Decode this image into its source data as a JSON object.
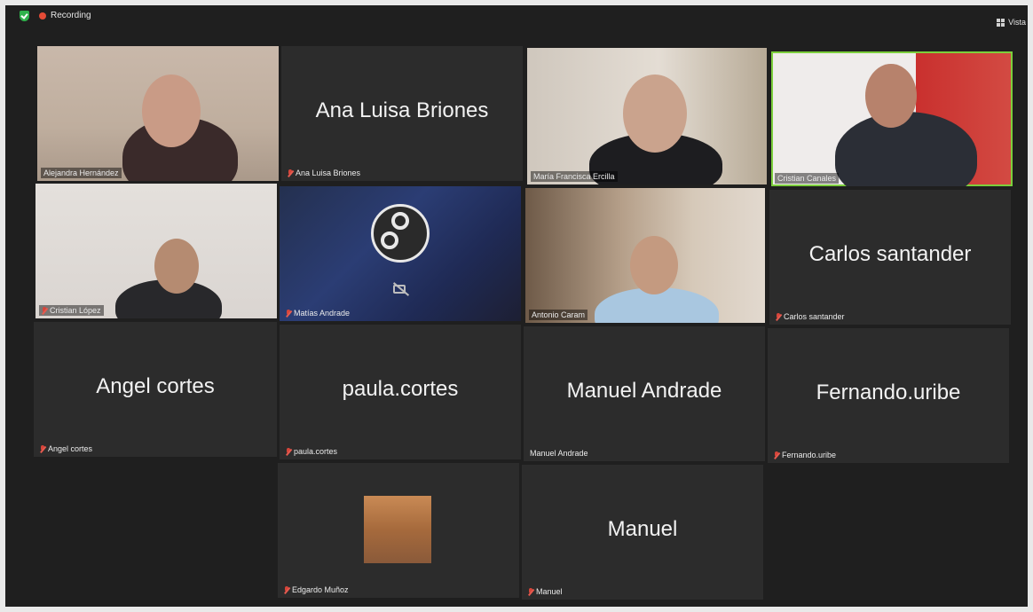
{
  "topbar": {
    "recording_label": "Recording",
    "view_label": "Vista"
  },
  "participants": [
    {
      "name": "Alejandra Hernández",
      "tile_label": "Alejandra Hernández",
      "video": true
    },
    {
      "name": "Ana Luisa Briones",
      "tile_label": "Ana Luisa Briones",
      "video": false,
      "muted": true
    },
    {
      "name": "María Francisca Ercilla",
      "tile_label": "María Francisca Ercilla",
      "video": true
    },
    {
      "name": "Cristian Canales",
      "tile_label": "Cristian Canales",
      "video": true,
      "speaking": true
    },
    {
      "name": "Cristian López",
      "tile_label": "Cristian López",
      "video": true,
      "muted": true
    },
    {
      "name": "Matías Andrade",
      "tile_label": "Matías Andrade",
      "video": false,
      "muted": true
    },
    {
      "name": "Antonio Caram",
      "tile_label": "Antonio Caram",
      "video": true
    },
    {
      "name": "Carlos santander",
      "tile_label": "Carlos santander",
      "video": false,
      "muted": true
    },
    {
      "name": "Angel cortes",
      "tile_label": "Angel cortes",
      "video": false,
      "muted": true
    },
    {
      "name": "paula.cortes",
      "tile_label": "paula.cortes",
      "video": false,
      "muted": true
    },
    {
      "name": "Manuel Andrade",
      "tile_label": "Manuel Andrade",
      "video": false
    },
    {
      "name": "Fernando.uribe",
      "tile_label": "Fernando.uribe",
      "video": false,
      "muted": true
    },
    {
      "name": "Edgardo Muñoz",
      "tile_label": "Edgardo Muñoz",
      "video": false,
      "muted": true
    },
    {
      "name": "Manuel",
      "tile_label": "Manuel",
      "video": false,
      "muted": true
    }
  ],
  "colors": {
    "background": "#1f1f1f",
    "tile": "#2c2c2c",
    "active_speaker": "#7ccf3c",
    "recording": "#e44b36",
    "muted_mic": "#d6453a"
  }
}
